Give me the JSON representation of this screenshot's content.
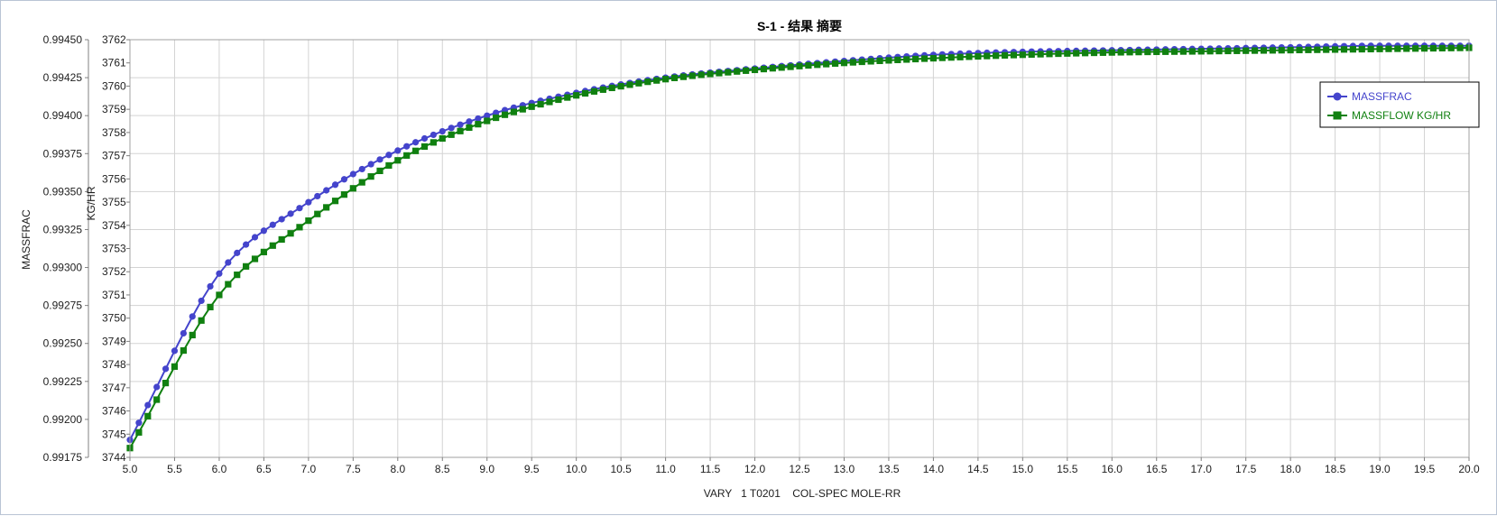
{
  "chart_data": {
    "type": "line",
    "title": "S-1 - 结果 摘要",
    "xlabel": "VARY   1 T0201    COL-SPEC MOLE-RR",
    "xlim": [
      5.0,
      20.0
    ],
    "x_ticks": [
      "5.0",
      "5.5",
      "6.0",
      "6.5",
      "7.0",
      "7.5",
      "8.0",
      "8.5",
      "9.0",
      "9.5",
      "10.0",
      "10.5",
      "11.0",
      "11.5",
      "12.0",
      "12.5",
      "13.0",
      "13.5",
      "14.0",
      "14.5",
      "15.0",
      "15.5",
      "16.0",
      "16.5",
      "17.0",
      "17.5",
      "18.0",
      "18.5",
      "19.0",
      "19.5",
      "20.0"
    ],
    "y_axes": [
      {
        "label": "MASSFRAC",
        "lim": [
          0.99175,
          0.9945
        ],
        "ticks": [
          "0.99175",
          "0.99200",
          "0.99225",
          "0.99250",
          "0.99275",
          "0.99300",
          "0.99325",
          "0.99350",
          "0.99375",
          "0.99400",
          "0.99425",
          "0.99450"
        ]
      },
      {
        "label": "KG/HR",
        "lim": [
          3744,
          3762
        ],
        "ticks": [
          "3744",
          "3745",
          "3746",
          "3747",
          "3748",
          "3749",
          "3750",
          "3751",
          "3752",
          "3753",
          "3754",
          "3755",
          "3756",
          "3757",
          "3758",
          "3759",
          "3760",
          "3761",
          "3762"
        ]
      }
    ],
    "grid": true,
    "legend_position": "top-right",
    "series": [
      {
        "name": "MASSFRAC",
        "axis": 0,
        "color": "#4444cc",
        "marker": "circle",
        "x": [
          5.0,
          6.0,
          7.0,
          8.0,
          9.0,
          10.0,
          11.0,
          12.0,
          13.0,
          14.0,
          15.0,
          16.0,
          17.0,
          18.0,
          19.0,
          20.0
        ],
        "y": [
          0.991865,
          0.99296,
          0.99343,
          0.99377,
          0.994,
          0.99415,
          0.99425,
          0.99431,
          0.99436,
          0.9944,
          0.99442,
          0.99443,
          0.99444,
          0.99445,
          0.99446,
          0.99446
        ]
      },
      {
        "name": "MASSFLOW      KG/HR",
        "axis": 1,
        "color": "#108010",
        "marker": "square",
        "x": [
          5.0,
          6.0,
          7.0,
          8.0,
          9.0,
          10.0,
          11.0,
          12.0,
          13.0,
          14.0,
          15.0,
          16.0,
          17.0,
          18.0,
          19.0,
          20.0
        ],
        "y": [
          3744.4,
          3751.0,
          3754.2,
          3756.8,
          3758.5,
          3759.6,
          3760.3,
          3760.7,
          3761.0,
          3761.2,
          3761.35,
          3761.45,
          3761.5,
          3761.55,
          3761.6,
          3761.65
        ]
      }
    ]
  }
}
